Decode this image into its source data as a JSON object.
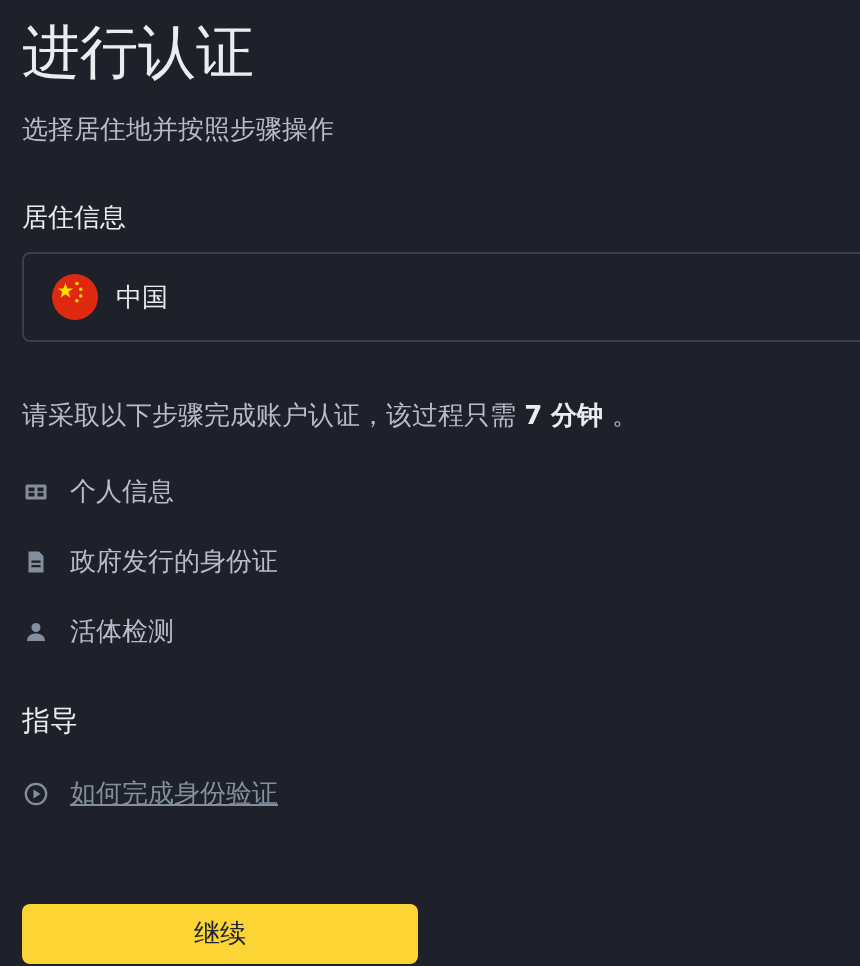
{
  "title": "进行认证",
  "subtitle": "选择居住地并按照步骤操作",
  "residence": {
    "label": "居住信息",
    "value": "中国"
  },
  "note": "请采取以下步骤完成账户认证，该过程只需 **7 分钟** 。",
  "steps": [
    {
      "kind": "card",
      "label": "个人信息"
    },
    {
      "kind": "document",
      "label": "政府发行的身份证"
    },
    {
      "kind": "person",
      "label": "活体检测"
    }
  ],
  "guide": {
    "heading": "指导",
    "link": "如何完成身份验证"
  },
  "continue_button": "继续"
}
